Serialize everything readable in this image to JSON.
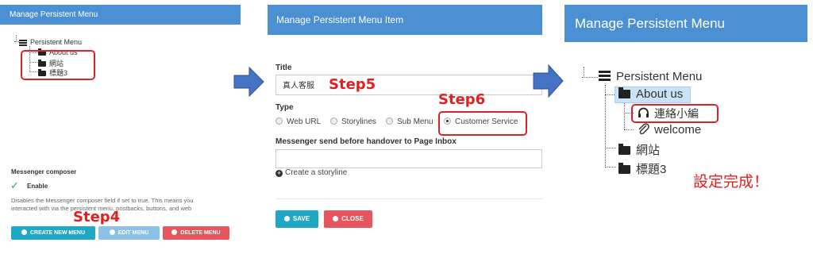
{
  "panel1": {
    "header": "Manage Persistent Menu",
    "tree": {
      "root": "Persistent Menu",
      "items": [
        "About us",
        "網站",
        "標題3"
      ]
    },
    "composer_label": "Messenger composer",
    "enable_label": "Enable",
    "description_line1": "Disables the Messenger composer field if set to true. This means you",
    "description_line2": "interacted with via the persistent menu, postbacks, buttons, and web",
    "step_label": "Step4",
    "buttons": {
      "create": "CREATE NEW MENU",
      "edit": "EDIT MENU",
      "delete": "DELETE MENU"
    }
  },
  "panel2": {
    "header": "Manage Persistent Menu Item",
    "title_label": "Title",
    "title_value": "真人客服",
    "step5": "Step5",
    "step6": "Step6",
    "type_label": "Type",
    "type_options": [
      "Web URL",
      "Storylines",
      "Sub Menu",
      "Customer Service"
    ],
    "selected_type": "Customer Service",
    "handover_label": "Messenger send before handover to Page Inbox",
    "create_storyline": "Create a storyline",
    "save": "SAVE",
    "close": "CLOSE"
  },
  "panel3": {
    "header": "Manage Persistent Menu",
    "tree": {
      "root": "Persistent Menu",
      "about": "About us",
      "sub_items": [
        "連絡小編",
        "welcome"
      ],
      "items": [
        "網站",
        "標題3"
      ]
    },
    "done_text": "設定完成！"
  },
  "colors": {
    "header_blue": "#4a90d2",
    "annotation_red": "#e02020",
    "teal_button": "#1fa8c4",
    "light_blue_button": "#8cc1ea",
    "red_button": "#e8545d",
    "arrow_blue": "#4472c4"
  }
}
